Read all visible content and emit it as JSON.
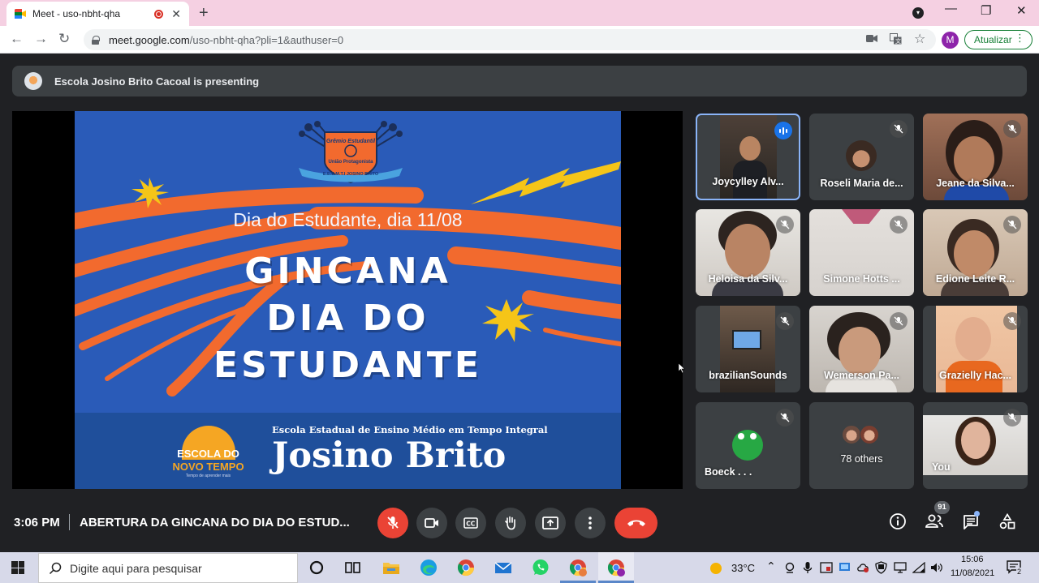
{
  "browser": {
    "tab_title": "Meet - uso-nbht-qha",
    "url_host": "meet.google.com",
    "url_path": "/uso-nbht-qha?pli=1&authuser=0",
    "profile_initial": "M",
    "update_label": "Atualizar"
  },
  "meet": {
    "presenting_banner": "Escola Josino Brito Cacoal is presenting",
    "time": "3:06 PM",
    "meeting_title": "ABERTURA DA GINCANA DO DIA DO ESTUD...",
    "participants_count": "91"
  },
  "slide": {
    "emblem_line1": "Grêmio Estudantil",
    "emblem_line2": "União Protagonista",
    "emblem_line3": "E.E.E.M.T.I JOSINO BRITO",
    "subtitle": "Dia do Estudante, dia 11/08",
    "title_line1": "GINCANA",
    "title_line2": "DIA DO",
    "title_line3": "ESTUDANTE",
    "logo_line1": "ESCOLA DO",
    "logo_line2": "NOVO TEMPO",
    "logo_line3": "Tempo de aprender mais",
    "school_line": "Escola Estadual de Ensino Médio em Tempo Integral",
    "school_name": "Josino Brito"
  },
  "participants": [
    {
      "name": "Joycylley Alv..."
    },
    {
      "name": "Roseli Maria de..."
    },
    {
      "name": "Jeane da Silva..."
    },
    {
      "name": "Heloisa da Silv..."
    },
    {
      "name": "Simone Hotts ..."
    },
    {
      "name": "Edione Leite R..."
    },
    {
      "name": "brazilianSounds"
    },
    {
      "name": "Wemerson Pa..."
    },
    {
      "name": "Grazielly Hac..."
    },
    {
      "name": "Boeck . . ."
    },
    {
      "name": "78 others"
    },
    {
      "name": "You"
    }
  ],
  "taskbar": {
    "search_placeholder": "Digite aqui para pesquisar",
    "weather": "33°C",
    "clock_time": "15:06",
    "clock_date": "11/08/2021",
    "notifications_count": "2"
  },
  "colors": {
    "meet_bg": "#202124",
    "tile_bg": "#3c4043",
    "accent_blue": "#8ab4f8",
    "hangup_red": "#ea4335",
    "slide_blue": "#2a5bb8",
    "slide_orange": "#f26a2e",
    "slide_yellow": "#f5c518"
  }
}
